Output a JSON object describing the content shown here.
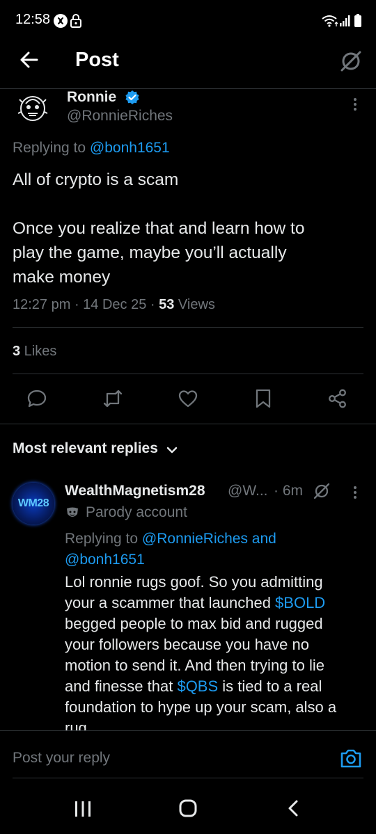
{
  "status_bar": {
    "time": "12:58"
  },
  "header": {
    "title": "Post"
  },
  "post": {
    "author_name": "Ronnie",
    "author_handle": "@RonnieRiches",
    "replying_label": "Replying to ",
    "replying_to": "@bonh1651",
    "text_line1": "All of crypto is a scam",
    "text_line2": "Once you realize that and learn how to",
    "text_line3": "play the game, maybe you’ll actually",
    "text_line4": "make money",
    "timestamp": "12:27 pm · 14 Dec 25 · ",
    "views_count": "53",
    "views_label": " Views",
    "likes_count": "3",
    "likes_label": " Likes"
  },
  "replies_sort": {
    "label": "Most relevant replies"
  },
  "reply": {
    "avatar_text": "WM28",
    "author_name": "WealthMagnetism28",
    "author_handle": "@W...",
    "time": "· 6m",
    "parody_label": "Parody account",
    "replying_label": "Replying to ",
    "replying_to_1": "@RonnieRiches",
    "replying_and": " and",
    "replying_to_2": "@bonh1651",
    "line1": "Lol ronnie rugs goof. So you admitting",
    "line2_a": "your a scammer that launched ",
    "line2_tag": "$BOLD",
    "line3": "begged people to max bid and rugged",
    "line4": "your followers because you have no",
    "line5": "motion to send it. And then trying to lie",
    "line6_a": "and finesse that ",
    "line6_tag": "$QBS",
    "line6_b": " is tied to a real",
    "line7": "foundation to hype up your scam, also a",
    "line8": "rug."
  },
  "composer": {
    "placeholder": "Post your reply"
  },
  "colors": {
    "accent": "#1d9bf0",
    "background": "#000000",
    "muted": "#71767b",
    "divider": "#2f3336"
  },
  "icons": [
    "back-arrow-icon",
    "grok-icon",
    "verified-badge-icon",
    "more-icon",
    "reply-icon",
    "repost-icon",
    "like-icon",
    "bookmark-icon",
    "share-icon",
    "chevron-down-icon",
    "camera-icon"
  ]
}
